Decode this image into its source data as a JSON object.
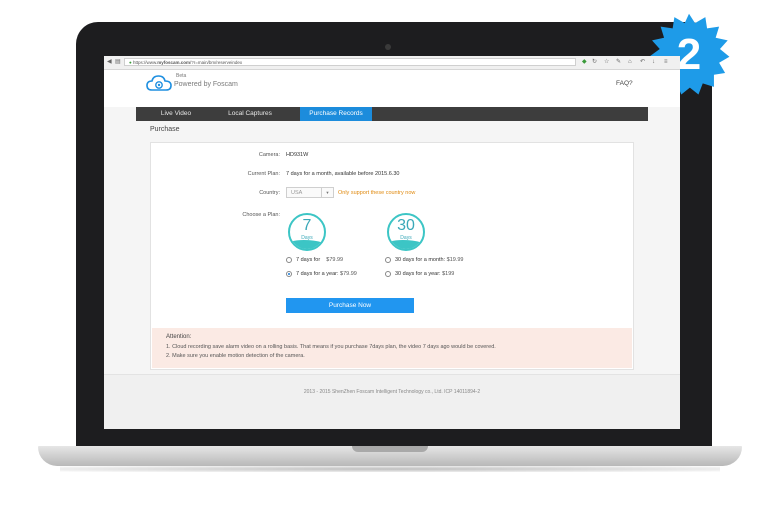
{
  "badge": {
    "number": "2"
  },
  "browser": {
    "url_prefix": "https://www.",
    "url_domain": "myfoscam.com",
    "url_path": "/?r=main/bm/reserveindex"
  },
  "header": {
    "beta": "Beta",
    "powered_by": "Powered by Foscam",
    "faq": "FAQ?"
  },
  "nav": {
    "items": [
      {
        "label": "Live Video"
      },
      {
        "label": "Local Captures"
      },
      {
        "label": "Purchase Records"
      }
    ]
  },
  "page": {
    "title": "Purchase"
  },
  "form": {
    "camera_label": "Camera:",
    "camera_value": "HD931W",
    "current_plan_label": "Current Plan:",
    "current_plan_value": "7 days for a month, available before 2015.6.30",
    "country_label": "Country:",
    "country_value": "USA",
    "country_note": "Only support these country now",
    "choose_plan_label": "Choose a Plan:"
  },
  "plans": [
    {
      "number": "7",
      "unit": "Days",
      "options": [
        {
          "label": "7 days for",
          "price": "$79.99",
          "checked": false
        },
        {
          "label": "7 days for a year:",
          "price": "$79.99",
          "checked": true
        }
      ]
    },
    {
      "number": "30",
      "unit": "Days",
      "options": [
        {
          "label": "30 days for a month:",
          "price": "$19.99",
          "checked": false
        },
        {
          "label": "30 days for a year:",
          "price": "$199",
          "checked": false
        }
      ]
    }
  ],
  "purchase_button": "Purchase Now",
  "attention": {
    "title": "Attention:",
    "lines": [
      "1. Cloud recording save alarm video on a rolling basis. That means if you purchase 7days plan, the video 7 days ago would be covered.",
      "2. Make sure you enable motion detection of the camera."
    ]
  },
  "footer": {
    "text": "2013 - 2015 ShenZhen Foscam Intelligent Technology co., Ltd.   ICP 14011894-2"
  },
  "colors": {
    "accent": "#2196f0",
    "nav_bg": "#3d3d3d",
    "badge": "#1e9be8",
    "plan_teal": "#3cc5c5",
    "note": "#e08a10"
  }
}
